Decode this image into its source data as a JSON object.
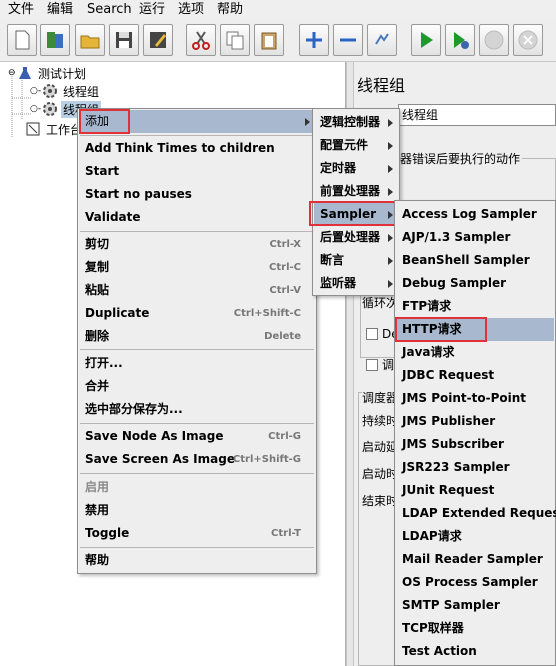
{
  "menubar": {
    "items": [
      "文件",
      "编辑",
      "Search",
      "运行",
      "选项",
      "帮助"
    ]
  },
  "toolbar": {
    "buttons": [
      "new-icon",
      "templates-icon",
      "open-icon",
      "save-icon",
      "save-as-icon",
      "cut-icon",
      "copy-icon",
      "paste-icon",
      "expand-icon",
      "collapse-icon",
      "toggle-icon",
      "start-icon",
      "start-no-pause-icon",
      "stop-icon",
      "shutdown-icon"
    ]
  },
  "tree": {
    "test_plan": "测试计划",
    "thread_group_1": "线程组",
    "thread_group_2": "线程组",
    "workbench": "工作台"
  },
  "right_panel": {
    "title": "线程组",
    "name_value": "线程组",
    "fragments": [
      "器错误后要执行的动作",
      "循环次",
      "De",
      "调",
      "调度器",
      "持续时",
      "启动延",
      "启动时",
      "结束时"
    ]
  },
  "context_menu": {
    "add": "添加",
    "items": [
      {
        "label": "Add Think Times to children",
        "shortcut": ""
      },
      {
        "label": "Start",
        "shortcut": ""
      },
      {
        "label": "Start no pauses",
        "shortcut": ""
      },
      {
        "label": "Validate",
        "shortcut": ""
      },
      {
        "label": "剪切",
        "shortcut": "Ctrl-X"
      },
      {
        "label": "复制",
        "shortcut": "Ctrl-C"
      },
      {
        "label": "粘贴",
        "shortcut": "Ctrl-V"
      },
      {
        "label": "Duplicate",
        "shortcut": "Ctrl+Shift-C"
      },
      {
        "label": "删除",
        "shortcut": "Delete"
      },
      {
        "label": "打开...",
        "shortcut": ""
      },
      {
        "label": "合并",
        "shortcut": ""
      },
      {
        "label": "选中部分保存为...",
        "shortcut": ""
      },
      {
        "label": "Save Node As Image",
        "shortcut": "Ctrl-G"
      },
      {
        "label": "Save Screen As Image",
        "shortcut": "Ctrl+Shift-G"
      },
      {
        "label": "启用",
        "shortcut": "",
        "disabled": true
      },
      {
        "label": "禁用",
        "shortcut": ""
      },
      {
        "label": "Toggle",
        "shortcut": "Ctrl-T"
      },
      {
        "label": "帮助",
        "shortcut": ""
      }
    ]
  },
  "add_submenu": {
    "items": [
      "逻辑控制器",
      "配置元件",
      "定时器",
      "前置处理器",
      "Sampler",
      "后置处理器",
      "断言",
      "监听器"
    ]
  },
  "sampler_submenu": {
    "items": [
      "Access Log Sampler",
      "AJP/1.3 Sampler",
      "BeanShell Sampler",
      "Debug Sampler",
      "FTP请求",
      "HTTP请求",
      "Java请求",
      "JDBC Request",
      "JMS Point-to-Point",
      "JMS Publisher",
      "JMS Subscriber",
      "JSR223 Sampler",
      "JUnit Request",
      "LDAP Extended Request",
      "LDAP请求",
      "Mail Reader Sampler",
      "OS Process Sampler",
      "SMTP Sampler",
      "TCP取样器",
      "Test Action"
    ]
  },
  "colors": {
    "highlight": "#a8b8cf",
    "annotation": "#e0303a",
    "selection": "#b8cfe5"
  }
}
